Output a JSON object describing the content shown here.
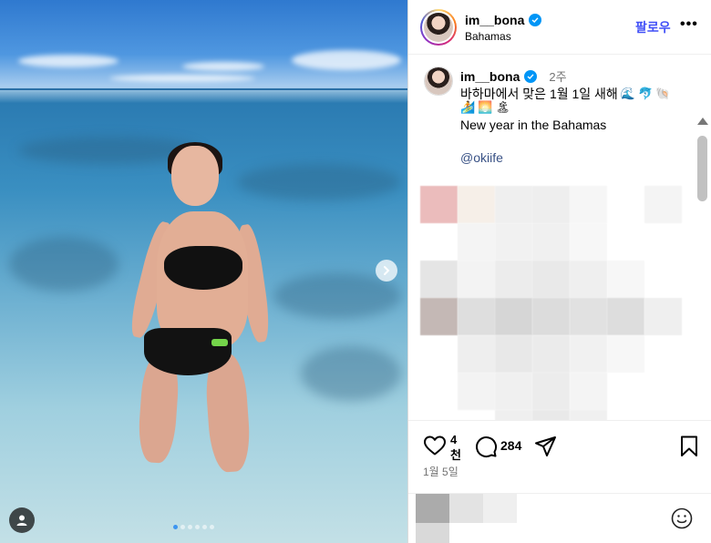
{
  "post": {
    "username": "im__bona",
    "location": "Bahamas",
    "follow_label": "팔로우",
    "more_label": "•••"
  },
  "caption": {
    "username": "im__bona",
    "time_ago": "2주",
    "line1": "바하마에서 맞은 1월 1일 새해",
    "line1_emojis": [
      "🌊",
      "🐬",
      "🐚"
    ],
    "line2_emojis": [
      "🏄",
      "🌅",
      "🏝"
    ],
    "line2": "New year in the Bahamas",
    "mention": "@okiife"
  },
  "actions": {
    "like_count": "4천",
    "comment_count": "284",
    "date": "1월 5일"
  },
  "carousel": {
    "total_slides": 6,
    "active_slide": 1
  },
  "colors": {
    "accent_blue": "#0095f6",
    "follow_text": "#4150f7",
    "mention": "#385185"
  }
}
